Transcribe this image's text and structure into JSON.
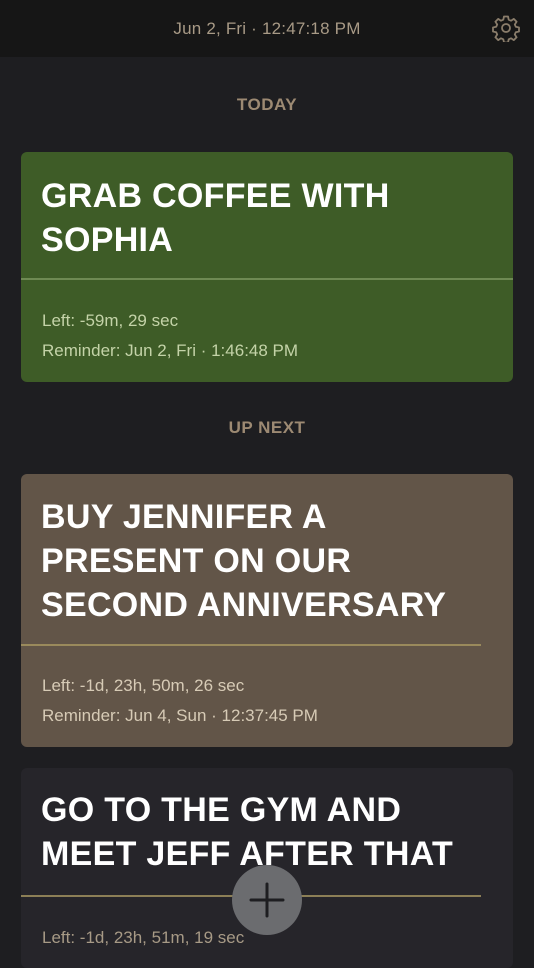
{
  "header": {
    "datetime": "Jun 2, Fri · 12:47:18 PM"
  },
  "sections": {
    "today": "TODAY",
    "up_next": "UP NEXT"
  },
  "cards": [
    {
      "title": "GRAB COFFEE WITH SOPHIA",
      "left": "Left: -59m, 29 sec",
      "reminder": "Reminder: Jun 2, Fri · 1:46:48 PM",
      "color": "#3e5c27"
    },
    {
      "title": "BUY JENNIFER A PRESENT ON OUR SECOND ANNIVERSARY",
      "left": "Left: -1d, 23h, 50m, 26 sec",
      "reminder": "Reminder: Jun 4, Sun · 12:37:45 PM",
      "color": "#625548"
    },
    {
      "title": "GO TO THE GYM AND MEET JEFF AFTER THAT",
      "left": "Left: -1d, 23h, 51m, 19 sec",
      "color": "#26252a"
    }
  ],
  "icons": {
    "settings": "gear-icon",
    "add": "plus-icon"
  }
}
